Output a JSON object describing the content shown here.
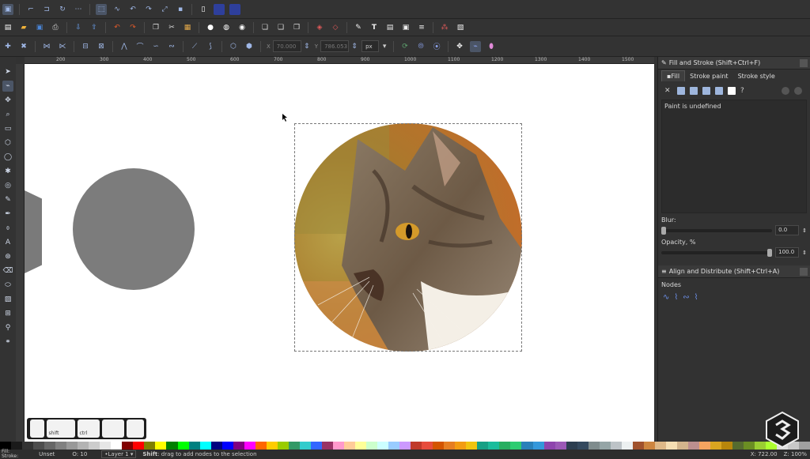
{
  "tool_controls": {
    "x_value": "70.000",
    "y_value": "786.053",
    "unit": "px"
  },
  "rulers": {
    "h_ticks": [
      "200",
      "300",
      "400",
      "500",
      "600",
      "700",
      "800",
      "900",
      "1000",
      "1100",
      "1200",
      "1300",
      "1400",
      "1500"
    ]
  },
  "keys": {
    "items": [
      "",
      "shift",
      "ctrl",
      "",
      ""
    ]
  },
  "fill_stroke": {
    "title": "Fill and Stroke (Shift+Ctrl+F)",
    "tabs": [
      "Fill",
      "Stroke paint",
      "Stroke style"
    ],
    "paint_status": "Paint is undefined",
    "blur_label": "Blur:",
    "blur_value": "0.0",
    "opacity_label": "Opacity, %",
    "opacity_value": "100.0"
  },
  "align": {
    "title": "Align and Distribute (Shift+Ctrl+A)",
    "nodes_label": "Nodes"
  },
  "status": {
    "fill_label": "Fill:",
    "stroke_label": "Stroke:",
    "fill_value": "Unset",
    "opacity_label": "O:",
    "opacity_value": "10",
    "layer": "•Layer 1",
    "message_bold": "Shift",
    "message": ": drag to add nodes to the selection",
    "coord_x_label": "X:",
    "coord_x": "722.00",
    "zoom_label": "Z:",
    "zoom": "100%"
  },
  "palette_colors": [
    "#000000",
    "#1a1a1a",
    "#333333",
    "#4d4d4d",
    "#666666",
    "#808080",
    "#999999",
    "#b3b3b3",
    "#cccccc",
    "#e6e6e6",
    "#ffffff",
    "#800000",
    "#ff0000",
    "#808000",
    "#ffff00",
    "#008000",
    "#00ff00",
    "#008080",
    "#00ffff",
    "#000080",
    "#0000ff",
    "#800080",
    "#ff00ff",
    "#ff6600",
    "#ffcc00",
    "#99cc00",
    "#339966",
    "#33cccc",
    "#3366ff",
    "#993366",
    "#ff99cc",
    "#ffcc99",
    "#ffff99",
    "#ccffcc",
    "#ccffff",
    "#99ccff",
    "#cc99ff",
    "#c0392b",
    "#e74c3c",
    "#d35400",
    "#e67e22",
    "#f39c12",
    "#f1c40f",
    "#16a085",
    "#1abc9c",
    "#27ae60",
    "#2ecc71",
    "#2980b9",
    "#3498db",
    "#8e44ad",
    "#9b59b6",
    "#2c3e50",
    "#34495e",
    "#7f8c8d",
    "#95a5a6",
    "#bdc3c7",
    "#ecf0f1",
    "#a0522d",
    "#cd853f",
    "#deb887",
    "#f5deb3",
    "#d2b48c",
    "#bc8f8f",
    "#f4a460",
    "#daa520",
    "#b8860b",
    "#556b2f",
    "#6b8e23",
    "#9acd32",
    "#adff2f",
    "#dddddd",
    "#c8c8c8",
    "#a0a0a0"
  ]
}
